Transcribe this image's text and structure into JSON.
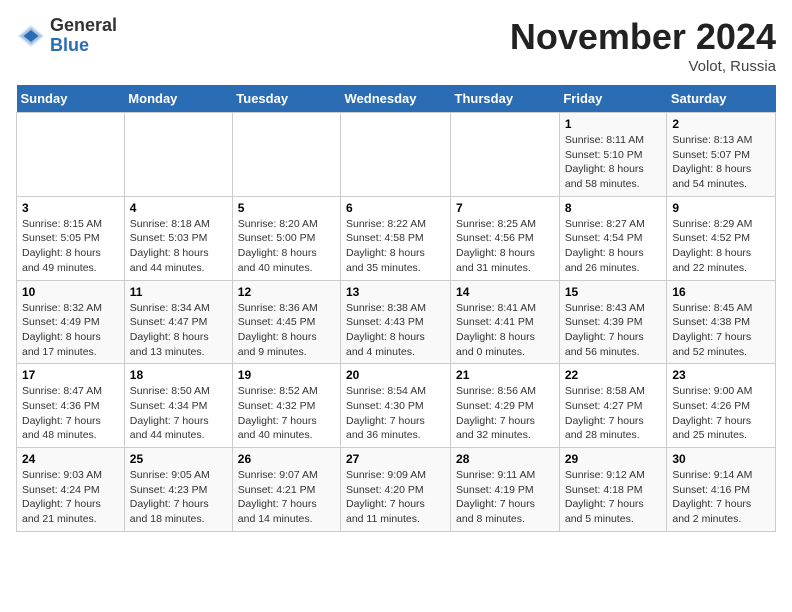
{
  "header": {
    "logo_general": "General",
    "logo_blue": "Blue",
    "month_title": "November 2024",
    "location": "Volot, Russia"
  },
  "days_of_week": [
    "Sunday",
    "Monday",
    "Tuesday",
    "Wednesday",
    "Thursday",
    "Friday",
    "Saturday"
  ],
  "weeks": [
    [
      {
        "day": "",
        "info": ""
      },
      {
        "day": "",
        "info": ""
      },
      {
        "day": "",
        "info": ""
      },
      {
        "day": "",
        "info": ""
      },
      {
        "day": "",
        "info": ""
      },
      {
        "day": "1",
        "info": "Sunrise: 8:11 AM\nSunset: 5:10 PM\nDaylight: 8 hours and 58 minutes."
      },
      {
        "day": "2",
        "info": "Sunrise: 8:13 AM\nSunset: 5:07 PM\nDaylight: 8 hours and 54 minutes."
      }
    ],
    [
      {
        "day": "3",
        "info": "Sunrise: 8:15 AM\nSunset: 5:05 PM\nDaylight: 8 hours and 49 minutes."
      },
      {
        "day": "4",
        "info": "Sunrise: 8:18 AM\nSunset: 5:03 PM\nDaylight: 8 hours and 44 minutes."
      },
      {
        "day": "5",
        "info": "Sunrise: 8:20 AM\nSunset: 5:00 PM\nDaylight: 8 hours and 40 minutes."
      },
      {
        "day": "6",
        "info": "Sunrise: 8:22 AM\nSunset: 4:58 PM\nDaylight: 8 hours and 35 minutes."
      },
      {
        "day": "7",
        "info": "Sunrise: 8:25 AM\nSunset: 4:56 PM\nDaylight: 8 hours and 31 minutes."
      },
      {
        "day": "8",
        "info": "Sunrise: 8:27 AM\nSunset: 4:54 PM\nDaylight: 8 hours and 26 minutes."
      },
      {
        "day": "9",
        "info": "Sunrise: 8:29 AM\nSunset: 4:52 PM\nDaylight: 8 hours and 22 minutes."
      }
    ],
    [
      {
        "day": "10",
        "info": "Sunrise: 8:32 AM\nSunset: 4:49 PM\nDaylight: 8 hours and 17 minutes."
      },
      {
        "day": "11",
        "info": "Sunrise: 8:34 AM\nSunset: 4:47 PM\nDaylight: 8 hours and 13 minutes."
      },
      {
        "day": "12",
        "info": "Sunrise: 8:36 AM\nSunset: 4:45 PM\nDaylight: 8 hours and 9 minutes."
      },
      {
        "day": "13",
        "info": "Sunrise: 8:38 AM\nSunset: 4:43 PM\nDaylight: 8 hours and 4 minutes."
      },
      {
        "day": "14",
        "info": "Sunrise: 8:41 AM\nSunset: 4:41 PM\nDaylight: 8 hours and 0 minutes."
      },
      {
        "day": "15",
        "info": "Sunrise: 8:43 AM\nSunset: 4:39 PM\nDaylight: 7 hours and 56 minutes."
      },
      {
        "day": "16",
        "info": "Sunrise: 8:45 AM\nSunset: 4:38 PM\nDaylight: 7 hours and 52 minutes."
      }
    ],
    [
      {
        "day": "17",
        "info": "Sunrise: 8:47 AM\nSunset: 4:36 PM\nDaylight: 7 hours and 48 minutes."
      },
      {
        "day": "18",
        "info": "Sunrise: 8:50 AM\nSunset: 4:34 PM\nDaylight: 7 hours and 44 minutes."
      },
      {
        "day": "19",
        "info": "Sunrise: 8:52 AM\nSunset: 4:32 PM\nDaylight: 7 hours and 40 minutes."
      },
      {
        "day": "20",
        "info": "Sunrise: 8:54 AM\nSunset: 4:30 PM\nDaylight: 7 hours and 36 minutes."
      },
      {
        "day": "21",
        "info": "Sunrise: 8:56 AM\nSunset: 4:29 PM\nDaylight: 7 hours and 32 minutes."
      },
      {
        "day": "22",
        "info": "Sunrise: 8:58 AM\nSunset: 4:27 PM\nDaylight: 7 hours and 28 minutes."
      },
      {
        "day": "23",
        "info": "Sunrise: 9:00 AM\nSunset: 4:26 PM\nDaylight: 7 hours and 25 minutes."
      }
    ],
    [
      {
        "day": "24",
        "info": "Sunrise: 9:03 AM\nSunset: 4:24 PM\nDaylight: 7 hours and 21 minutes."
      },
      {
        "day": "25",
        "info": "Sunrise: 9:05 AM\nSunset: 4:23 PM\nDaylight: 7 hours and 18 minutes."
      },
      {
        "day": "26",
        "info": "Sunrise: 9:07 AM\nSunset: 4:21 PM\nDaylight: 7 hours and 14 minutes."
      },
      {
        "day": "27",
        "info": "Sunrise: 9:09 AM\nSunset: 4:20 PM\nDaylight: 7 hours and 11 minutes."
      },
      {
        "day": "28",
        "info": "Sunrise: 9:11 AM\nSunset: 4:19 PM\nDaylight: 7 hours and 8 minutes."
      },
      {
        "day": "29",
        "info": "Sunrise: 9:12 AM\nSunset: 4:18 PM\nDaylight: 7 hours and 5 minutes."
      },
      {
        "day": "30",
        "info": "Sunrise: 9:14 AM\nSunset: 4:16 PM\nDaylight: 7 hours and 2 minutes."
      }
    ]
  ]
}
